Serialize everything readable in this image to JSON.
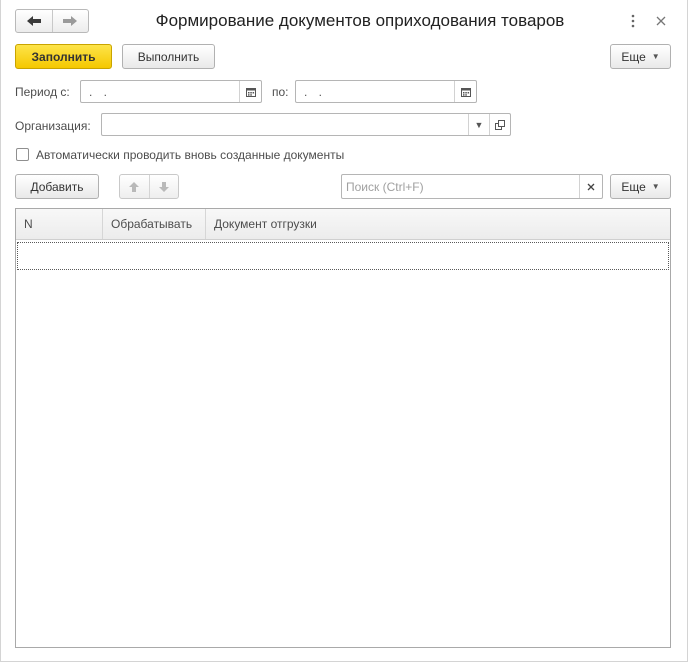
{
  "window": {
    "title": "Формирование документов оприходования товаров",
    "more_icon": "kebab-vertical-icon",
    "close_icon": "close-icon"
  },
  "nav": {
    "back_icon": "arrow-left-icon",
    "forward_icon": "arrow-right-icon"
  },
  "toolbar": {
    "fill_label": "Заполнить",
    "execute_label": "Выполнить",
    "more_label": "Еще"
  },
  "period": {
    "from_label": "Период с:",
    "from_value": ". .",
    "to_label": "по:",
    "to_value": ". ."
  },
  "organization": {
    "label": "Организация:",
    "value": ""
  },
  "auto_post": {
    "label": "Автоматически проводить вновь созданные документы",
    "checked": false
  },
  "table_toolbar": {
    "add_label": "Добавить",
    "search_placeholder": "Поиск (Ctrl+F)",
    "more_label": "Еще"
  },
  "table": {
    "columns": [
      "N",
      "Обрабатывать",
      "Документ отгрузки"
    ],
    "rows": []
  },
  "colors": {
    "accent_button": "#f5c800",
    "border": "#b5b5b5"
  }
}
